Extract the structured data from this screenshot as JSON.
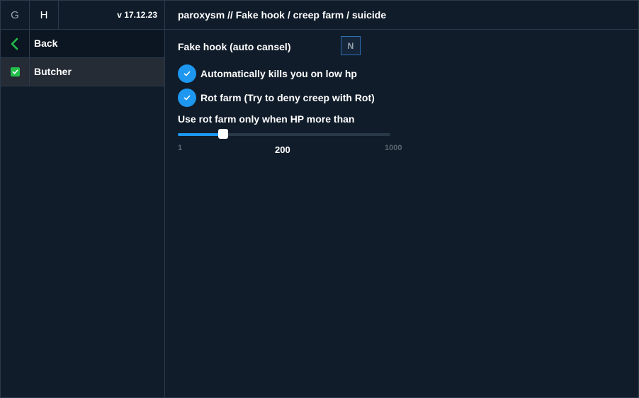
{
  "sidebar": {
    "tabs": [
      {
        "label": "G"
      },
      {
        "label": "H"
      }
    ],
    "version": "v 17.12.23",
    "items": [
      {
        "label": "Back",
        "icon": "chevron-left-icon"
      },
      {
        "label": "Butcher",
        "icon": "check-icon"
      }
    ]
  },
  "header": {
    "breadcrumb": "paroxysm // Fake hook / creep farm / suicide"
  },
  "settings": {
    "fake_hook_label": "Fake hook (auto cansel)",
    "fake_hook_key": "N",
    "auto_kill_label": "Automatically kills you on low hp",
    "auto_kill_checked": true,
    "rot_farm_label": "Rot farm (Try to deny creep with Rot)",
    "rot_farm_checked": true,
    "hp_slider": {
      "label": "Use rot farm only when HP more than",
      "min": 1,
      "max": 1000,
      "value": 200,
      "min_label": "1",
      "max_label": "1000",
      "value_label": "200"
    }
  },
  "colors": {
    "accent": "#1d97f0",
    "success": "#22c04a",
    "background": "#101c2a"
  }
}
